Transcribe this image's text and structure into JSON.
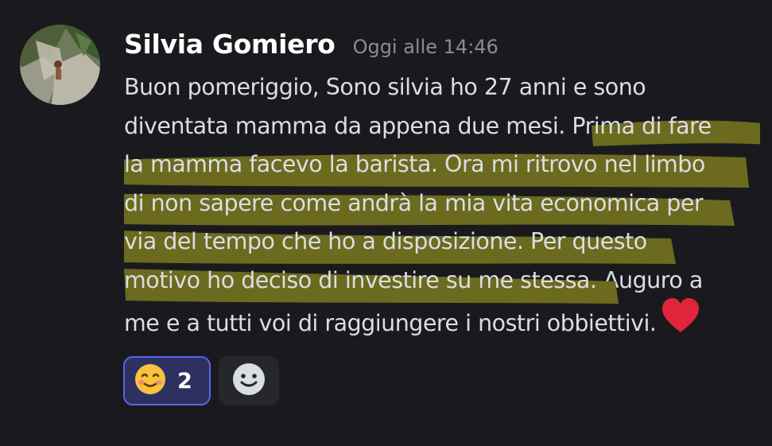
{
  "message": {
    "author": "Silvia Gomiero",
    "timestamp": "Oggi alle 14:46",
    "lines": [
      {
        "plain": "Buon pomeriggio, Sono silvia ho 27 anni e sono",
        "highlighted": ""
      },
      {
        "plain": "diventata mamma da appena due mesi. ",
        "highlighted": "Prima di fare"
      },
      {
        "plain": "",
        "highlighted": "la mamma facevo la barista. Ora mi ritrovo nel limbo"
      },
      {
        "plain": "",
        "highlighted": "di non sapere come andrà la mia vita economica per"
      },
      {
        "plain": "",
        "highlighted": "via del tempo che ho a disposizione. Per questo"
      },
      {
        "plain": "",
        "highlighted": "motivo ho deciso di investire su me stessa.",
        "after": " Auguro a"
      },
      {
        "plain": "me e a tutti voi di raggiungere i nostri obbiettivi.",
        "highlighted": "",
        "emoji": "heart-emoji"
      }
    ],
    "highlight_color": "#6b6a1e"
  },
  "reactions": [
    {
      "emoji": "smiling-face-with-smiling-eyes",
      "count": "2",
      "active": true
    },
    {
      "emoji": "add-reaction-icon",
      "count": "",
      "active": false
    }
  ],
  "colors": {
    "background": "#1a1a1e",
    "author": "#ffffff",
    "timestamp": "#8a8c93",
    "text": "#dbdee1",
    "reaction_active_bg": "#2e3160",
    "reaction_active_border": "#5865f2"
  }
}
